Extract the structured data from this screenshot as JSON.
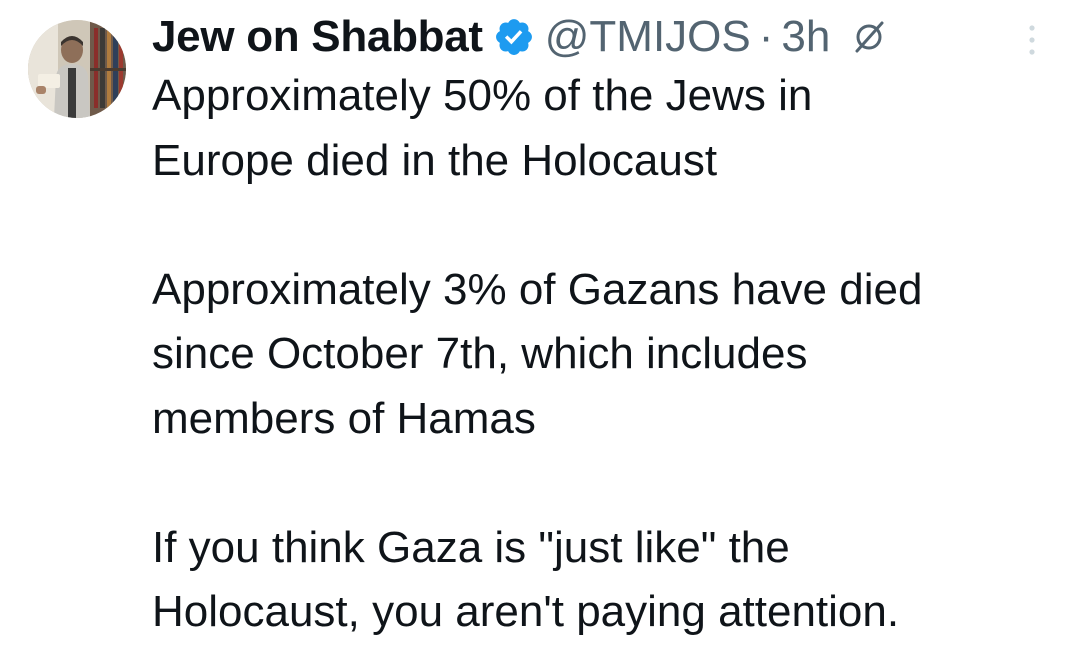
{
  "author": {
    "display_name": "Jew on Shabbat",
    "handle": "@TMIJOS",
    "separator": "·",
    "time": "3h",
    "verified_icon": "verified-badge-icon",
    "edited_icon": "edited-slash-icon"
  },
  "tweet": {
    "paragraphs": [
      "Approximately 50% of the Jews in\nEurope died in the Holocaust",
      "Approximately 3% of Gazans have died\nsince October 7th, which includes\nmembers of Hamas",
      "If you think Gaza is \"just like\" the\nHolocaust, you aren't paying attention."
    ]
  },
  "colors": {
    "text": "#0f1419",
    "secondary": "#536471",
    "verified": "#1d9bf0"
  }
}
